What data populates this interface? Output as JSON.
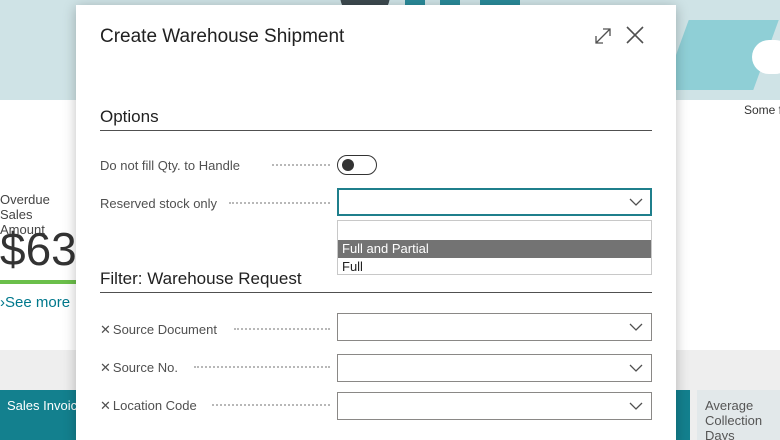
{
  "background": {
    "side_text": "Some f",
    "overdue_label": "Overdue Sales Amount",
    "overdue_value": "$63",
    "see_more": "See more",
    "tile_left_label": "Sales Invoices",
    "tile_right_label": "Average Collection Days"
  },
  "dialog": {
    "title": "Create Warehouse Shipment",
    "options_section": {
      "title": "Options",
      "do_not_fill_label": "Do not fill Qty. to Handle",
      "do_not_fill_value": false,
      "reserved_stock_label": "Reserved stock only",
      "reserved_stock_value": "",
      "reserved_stock_options": [
        "",
        "Full and Partial",
        "Full"
      ],
      "highlighted_option": "Full and Partial"
    },
    "filter_section": {
      "title": "Filter: Warehouse Request",
      "fields": [
        {
          "label": "Source Document",
          "value": ""
        },
        {
          "label": "Source No.",
          "value": ""
        },
        {
          "label": "Location Code",
          "value": ""
        }
      ]
    }
  },
  "colors": {
    "accent": "#1f7f8c",
    "tile": "#13808e",
    "highlight": "#737373",
    "progress": "#6bbf4a"
  }
}
